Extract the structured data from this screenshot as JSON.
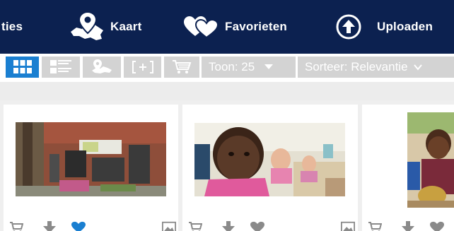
{
  "nav": {
    "collecties_label": "ties",
    "kaart_label": "Kaart",
    "favorieten_label": "Favorieten",
    "uploaden_label": "Uploaden",
    "icons": [
      "map-pin-belgium-icon",
      "hearts-icon",
      "upload-arrow-icon"
    ]
  },
  "toolbar": {
    "view_buttons": [
      "grid-view-icon",
      "list-view-icon",
      "map-view-icon",
      "select-icon",
      "cart-icon"
    ],
    "toon_label": "Toon: 25",
    "sorteer_label": "Sorteer: Relevantie"
  },
  "cards": [
    {
      "photo": "brick-building-photo",
      "actions": [
        "cart-icon",
        "download-icon",
        "heart-icon",
        "image-icon"
      ],
      "favorited": true
    },
    {
      "photo": "child-in-classroom-photo",
      "actions": [
        "cart-icon",
        "download-icon",
        "heart-icon",
        "image-icon"
      ],
      "favorited": false
    },
    {
      "photo": "child-with-toy-photo",
      "actions": [
        "cart-icon",
        "download-icon",
        "heart-icon"
      ],
      "favorited": false
    }
  ],
  "colors": {
    "nav_bg": "#0c2150",
    "active_button": "#1a7fd1",
    "inactive_button": "#d3d3d3",
    "favorite_heart": "#1a7fd1",
    "action_icon": "#8a8a8a"
  }
}
